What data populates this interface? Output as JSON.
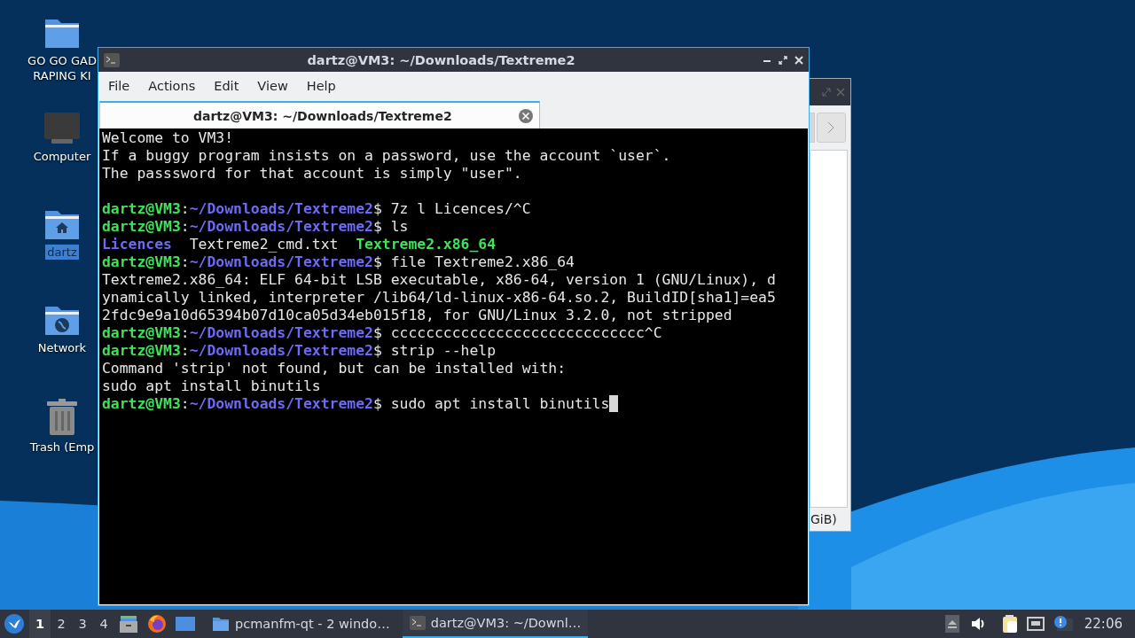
{
  "desktop_icons": [
    {
      "kind": "folder",
      "label": "GO GO GAD\nRAPING KI"
    },
    {
      "kind": "computer",
      "label": "Computer"
    },
    {
      "kind": "home",
      "label": "dartz",
      "selected": true
    },
    {
      "kind": "network",
      "label": "Network"
    },
    {
      "kind": "trash",
      "label": "Trash (Emp"
    }
  ],
  "back_window": {
    "status": "GiB)"
  },
  "terminal_window": {
    "title": "dartz@VM3: ~/Downloads/Textreme2",
    "menu": [
      "File",
      "Actions",
      "Edit",
      "View",
      "Help"
    ],
    "tabs": [
      {
        "label": "dartz@VM3: ~/Downloads/Textreme2",
        "selected": true
      }
    ],
    "cursor": true,
    "lines": [
      {
        "segments": [
          {
            "kind": "text",
            "text": "Welcome to VM3!"
          }
        ]
      },
      {
        "segments": [
          {
            "kind": "text",
            "text": "If a buggy program insists on a password, use the account `user`."
          }
        ]
      },
      {
        "segments": [
          {
            "kind": "text",
            "text": "The passsword for that account is simply \"user\"."
          }
        ]
      },
      {
        "blank_before": true,
        "segments": [
          {
            "kind": "user",
            "text": "dartz@VM3"
          },
          {
            "kind": "text",
            "text": ":"
          },
          {
            "kind": "path",
            "text": "~/Downloads/Textreme2"
          },
          {
            "kind": "text",
            "text": "$ 7z l Licences/^C"
          }
        ]
      },
      {
        "segments": [
          {
            "kind": "user",
            "text": "dartz@VM3"
          },
          {
            "kind": "text",
            "text": ":"
          },
          {
            "kind": "path",
            "text": "~/Downloads/Textreme2"
          },
          {
            "kind": "text",
            "text": "$ ls"
          }
        ]
      },
      {
        "segments": [
          {
            "kind": "dir",
            "text": "Licences"
          },
          {
            "kind": "text",
            "text": "  Textreme2_cmd.txt  "
          },
          {
            "kind": "exec",
            "text": "Textreme2.x86_64"
          }
        ]
      },
      {
        "segments": [
          {
            "kind": "user",
            "text": "dartz@VM3"
          },
          {
            "kind": "text",
            "text": ":"
          },
          {
            "kind": "path",
            "text": "~/Downloads/Textreme2"
          },
          {
            "kind": "text",
            "text": "$ file Textreme2.x86_64"
          }
        ]
      },
      {
        "segments": [
          {
            "kind": "text",
            "text": "Textreme2.x86_64: ELF 64-bit LSB executable, x86-64, version 1 (GNU/Linux), d"
          }
        ]
      },
      {
        "segments": [
          {
            "kind": "text",
            "text": "ynamically linked, interpreter /lib64/ld-linux-x86-64.so.2, BuildID[sha1]=ea5"
          }
        ]
      },
      {
        "segments": [
          {
            "kind": "text",
            "text": "2fdc9e9a10d65394b07d10ca05d34eb015f18, for GNU/Linux 3.2.0, not stripped"
          }
        ]
      },
      {
        "segments": [
          {
            "kind": "user",
            "text": "dartz@VM3"
          },
          {
            "kind": "text",
            "text": ":"
          },
          {
            "kind": "path",
            "text": "~/Downloads/Textreme2"
          },
          {
            "kind": "text",
            "text": "$ ccccccccccccccccccccccccccccc^C"
          }
        ]
      },
      {
        "segments": [
          {
            "kind": "user",
            "text": "dartz@VM3"
          },
          {
            "kind": "text",
            "text": ":"
          },
          {
            "kind": "path",
            "text": "~/Downloads/Textreme2"
          },
          {
            "kind": "text",
            "text": "$ strip --help"
          }
        ]
      },
      {
        "segments": [
          {
            "kind": "text",
            "text": "Command 'strip' not found, but can be installed with:"
          }
        ]
      },
      {
        "segments": [
          {
            "kind": "text",
            "text": "sudo apt install binutils"
          }
        ]
      },
      {
        "segments": [
          {
            "kind": "user",
            "text": "dartz@VM3"
          },
          {
            "kind": "text",
            "text": ":"
          },
          {
            "kind": "path",
            "text": "~/Downloads/Textreme2"
          },
          {
            "kind": "text",
            "text": "$ sudo apt install binutils"
          }
        ]
      }
    ]
  },
  "taskbar": {
    "workspaces": [
      {
        "label": "1",
        "selected": true
      },
      {
        "label": "2",
        "selected": false
      },
      {
        "label": "3",
        "selected": false
      },
      {
        "label": "4",
        "selected": false
      }
    ],
    "tasks": [
      {
        "kind": "folder",
        "label": "pcmanfm-qt - 2 windo…",
        "selected": false
      },
      {
        "kind": "terminal",
        "label": "dartz@VM3: ~/Downl…",
        "selected": true
      }
    ],
    "clock": "22:06"
  }
}
